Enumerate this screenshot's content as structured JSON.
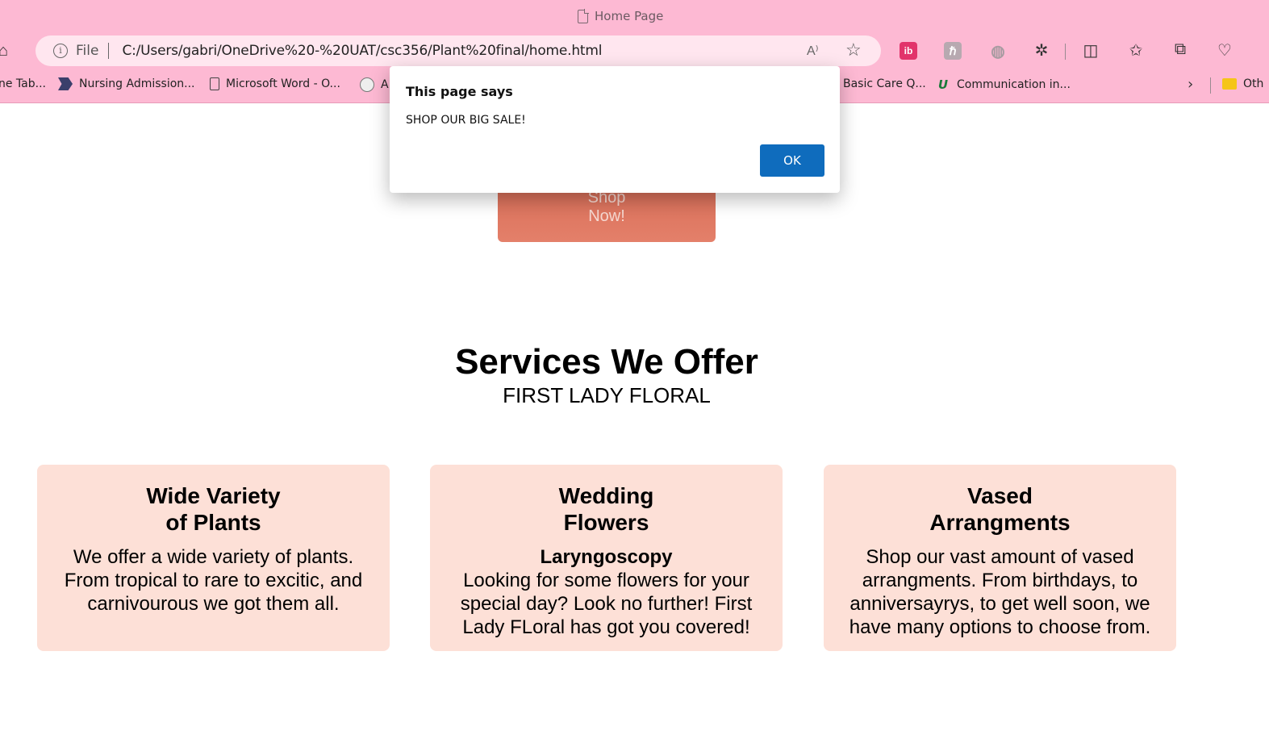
{
  "browser": {
    "tab_title": "Home Page",
    "address": {
      "scheme_label": "File",
      "url": "C:/Users/gabri/OneDrive%20-%20UAT/csc356/Plant%20final/home.html"
    },
    "extensions": {
      "ib_label": "ib"
    },
    "bookmarks": [
      {
        "label": "ne Tab..."
      },
      {
        "label": "Nursing Admission..."
      },
      {
        "label": "Microsoft Word - O..."
      },
      {
        "label": "A"
      },
      {
        "label": "Basic Care Q..."
      },
      {
        "label": "Communication in..."
      },
      {
        "label": "Oth"
      }
    ]
  },
  "page": {
    "shop_button_label": "Shop Now!",
    "services_title": "Services We Offer",
    "services_subtitle": "FIRST LADY FLORAL",
    "cards": [
      {
        "title_line1": "Wide Variety",
        "title_line2": "of Plants",
        "body": "We offer a wide variety of plants. From tropical to rare to excitic, and carnivourous we got them all."
      },
      {
        "title_line1": "Wedding",
        "title_line2": "Flowers",
        "subtitle": "Laryngoscopy",
        "body": "Looking for some flowers for your special day? Look no further! First Lady FLoral has got you covered!"
      },
      {
        "title_line1": "Vased",
        "title_line2": "Arrangments",
        "body": "Shop our vast amount of vased arrangments. From birthdays, to anniversayrys, to get well soon, we have many options to choose from."
      }
    ]
  },
  "dialog": {
    "title": "This page says",
    "message": "SHOP OUR BIG SALE!",
    "ok_label": "OK"
  },
  "colors": {
    "chrome_bg": "#fdb9d3",
    "card_bg": "#fde0d7",
    "shop_button": "#e07a63",
    "ok_button": "#0f6cbd"
  }
}
